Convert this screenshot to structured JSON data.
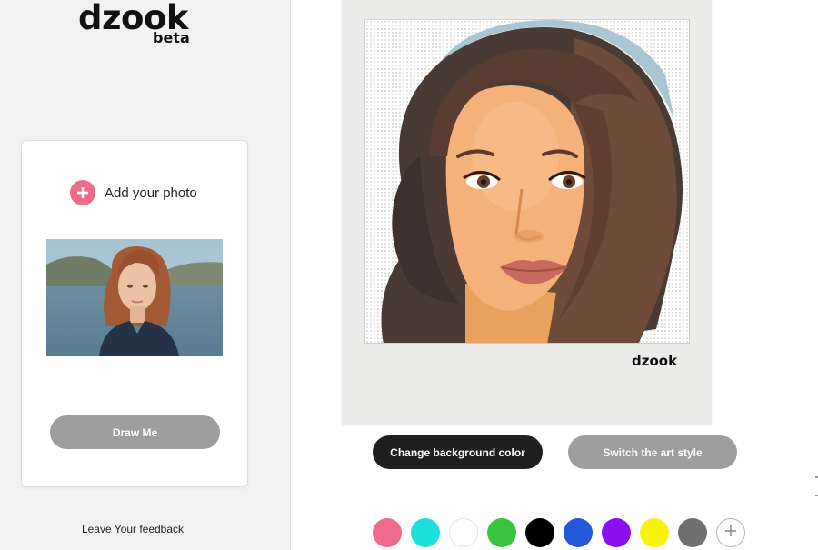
{
  "brand": {
    "name": "dzook",
    "tag": "beta"
  },
  "upload": {
    "add_photo_label": "Add your photo",
    "draw_button": "Draw Me"
  },
  "sidebar": {
    "feedback_link": "Leave Your feedback"
  },
  "result": {
    "watermark": "dzook"
  },
  "actions": {
    "change_bg_label": "Change background color",
    "switch_style_label": "Switch the art style"
  },
  "colors": {
    "swatches": [
      {
        "name": "pink",
        "hex": "#f06b8b"
      },
      {
        "name": "cyan",
        "hex": "#1ee0d8"
      },
      {
        "name": "white",
        "hex": "#ffffff"
      },
      {
        "name": "green",
        "hex": "#37c43f"
      },
      {
        "name": "black",
        "hex": "#000000"
      },
      {
        "name": "blue",
        "hex": "#2359d9"
      },
      {
        "name": "purple",
        "hex": "#8a0ff0"
      },
      {
        "name": "yellow",
        "hex": "#f8f20e"
      },
      {
        "name": "gray",
        "hex": "#6f6f6f"
      }
    ],
    "add_icon": "plus-icon",
    "primary_dark": "#1f1f1f",
    "button_gray": "#9e9e9e"
  }
}
